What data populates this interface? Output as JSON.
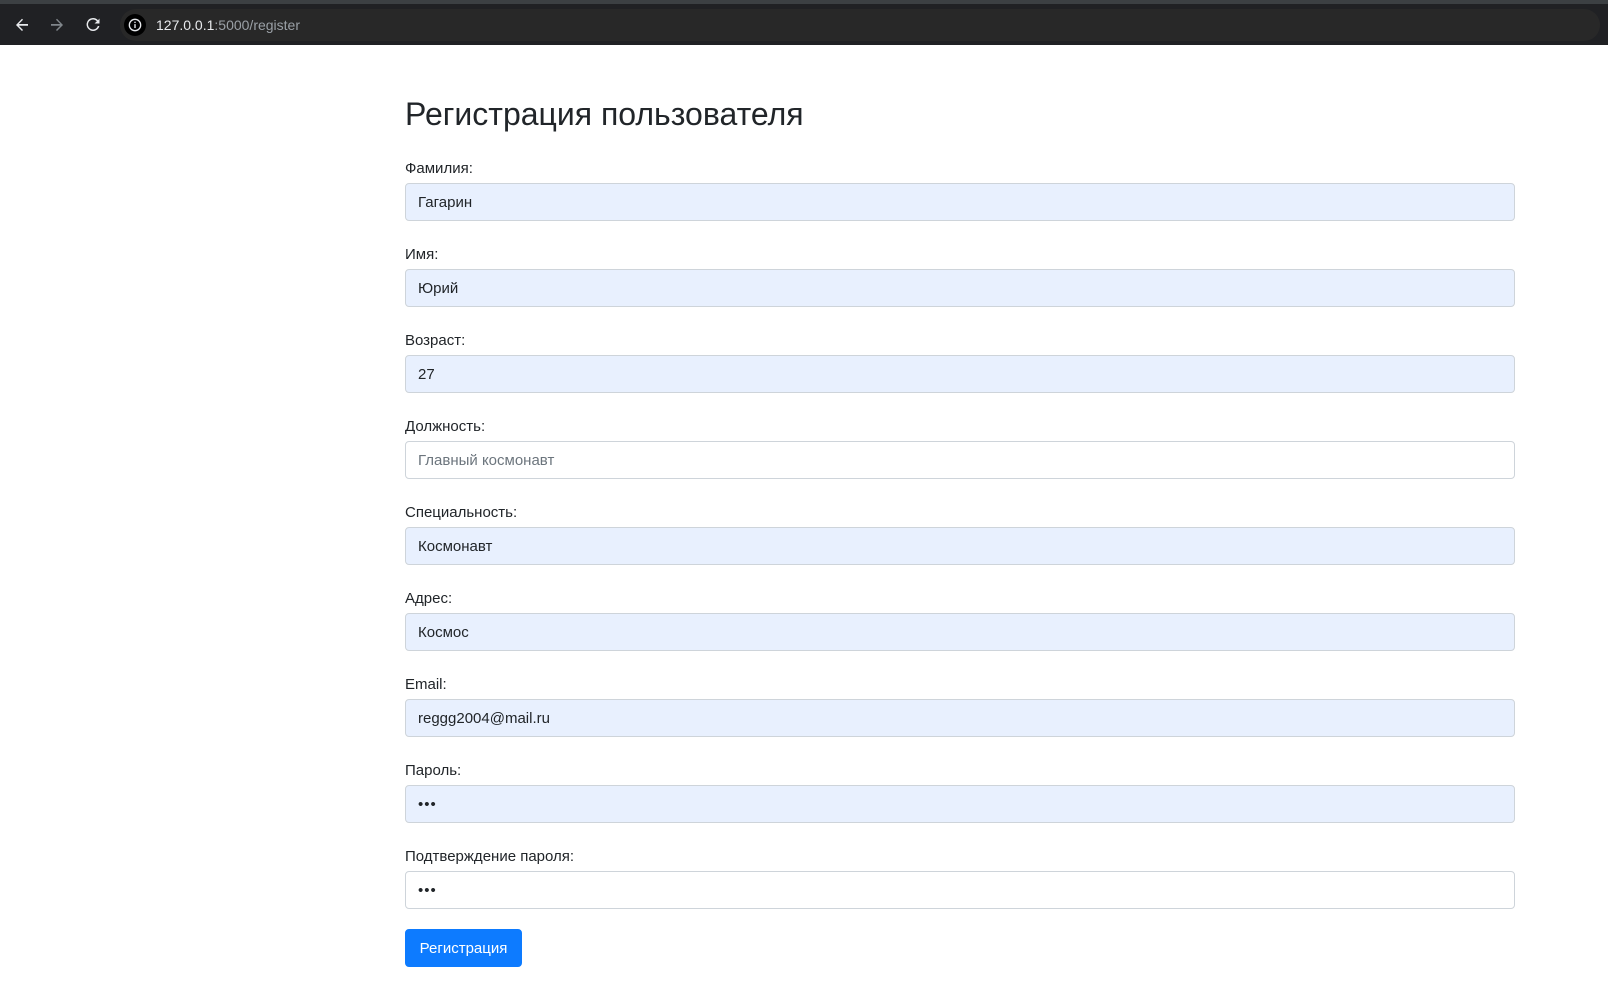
{
  "browser": {
    "url_host": "127.0.0.1",
    "url_path": ":5000/register",
    "icons": {
      "back": "back-arrow-icon",
      "forward": "forward-arrow-icon",
      "reload": "reload-icon",
      "info": "info-icon"
    }
  },
  "page": {
    "title": "Регистрация пользователя"
  },
  "form": {
    "fields": [
      {
        "label": "Фамилия:",
        "value": "Гагарин",
        "autofill": true
      },
      {
        "label": "Имя:",
        "value": "Юрий",
        "autofill": true
      },
      {
        "label": "Возраст:",
        "value": "27",
        "autofill": true
      },
      {
        "label": "Должность:",
        "value": "",
        "placeholder": "Главный космонавт",
        "autofill": false
      },
      {
        "label": "Специальность:",
        "value": "Космонавт",
        "autofill": true
      },
      {
        "label": "Адрес:",
        "value": "Космос",
        "autofill": true
      },
      {
        "label": "Email:",
        "value": "reggg2004@mail.ru",
        "autofill": true
      },
      {
        "label": "Пароль:",
        "value": "•••",
        "autofill": true
      },
      {
        "label": "Подтверждение пароля:",
        "value": "•••",
        "autofill": false
      }
    ],
    "submit_label": "Регистрация"
  },
  "colors": {
    "autofill_bg": "#e8f0fe",
    "primary": "#0d7bff",
    "browser_bar": "#202124"
  }
}
